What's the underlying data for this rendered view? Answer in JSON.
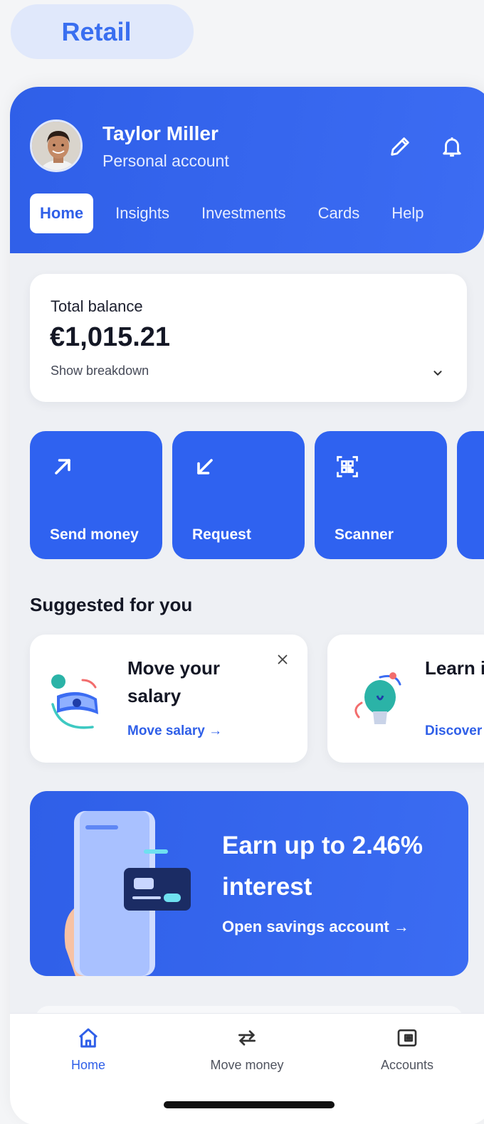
{
  "segment": {
    "label": "Retail"
  },
  "profile": {
    "name": "Taylor Miller",
    "account_type": "Personal account"
  },
  "header_icons": [
    "pencil-icon",
    "bell-icon"
  ],
  "tabs": [
    {
      "label": "Home",
      "active": true
    },
    {
      "label": "Insights"
    },
    {
      "label": "Investments"
    },
    {
      "label": "Cards"
    },
    {
      "label": "Help"
    }
  ],
  "balance": {
    "label": "Total balance",
    "amount": "€1,015.21",
    "breakdown": "Show breakdown"
  },
  "quick_actions": [
    {
      "label": "Send money",
      "icon": "arrow-up-right-icon"
    },
    {
      "label": "Request",
      "icon": "arrow-down-left-icon"
    },
    {
      "label": "Scanner",
      "icon": "qr-scanner-icon"
    },
    {
      "label": "",
      "icon": ""
    }
  ],
  "suggested": {
    "title": "Suggested for you",
    "cards": [
      {
        "title": "Move your salary",
        "link": "Move salary →"
      },
      {
        "title": "Learn insight",
        "link": "Discover"
      }
    ]
  },
  "promo": {
    "title": "Earn up to 2.46% interest",
    "link": "Open savings account →"
  },
  "bottom_nav": [
    {
      "label": "Home",
      "icon": "home-icon",
      "active": true
    },
    {
      "label": "Move money",
      "icon": "transfer-arrows-icon"
    },
    {
      "label": "Accounts",
      "icon": "wallet-icon"
    }
  ],
  "colors": {
    "primary": "#2F5FE8",
    "segment_bg": "#E0E8FB",
    "page_bg": "#EEF0F4"
  }
}
